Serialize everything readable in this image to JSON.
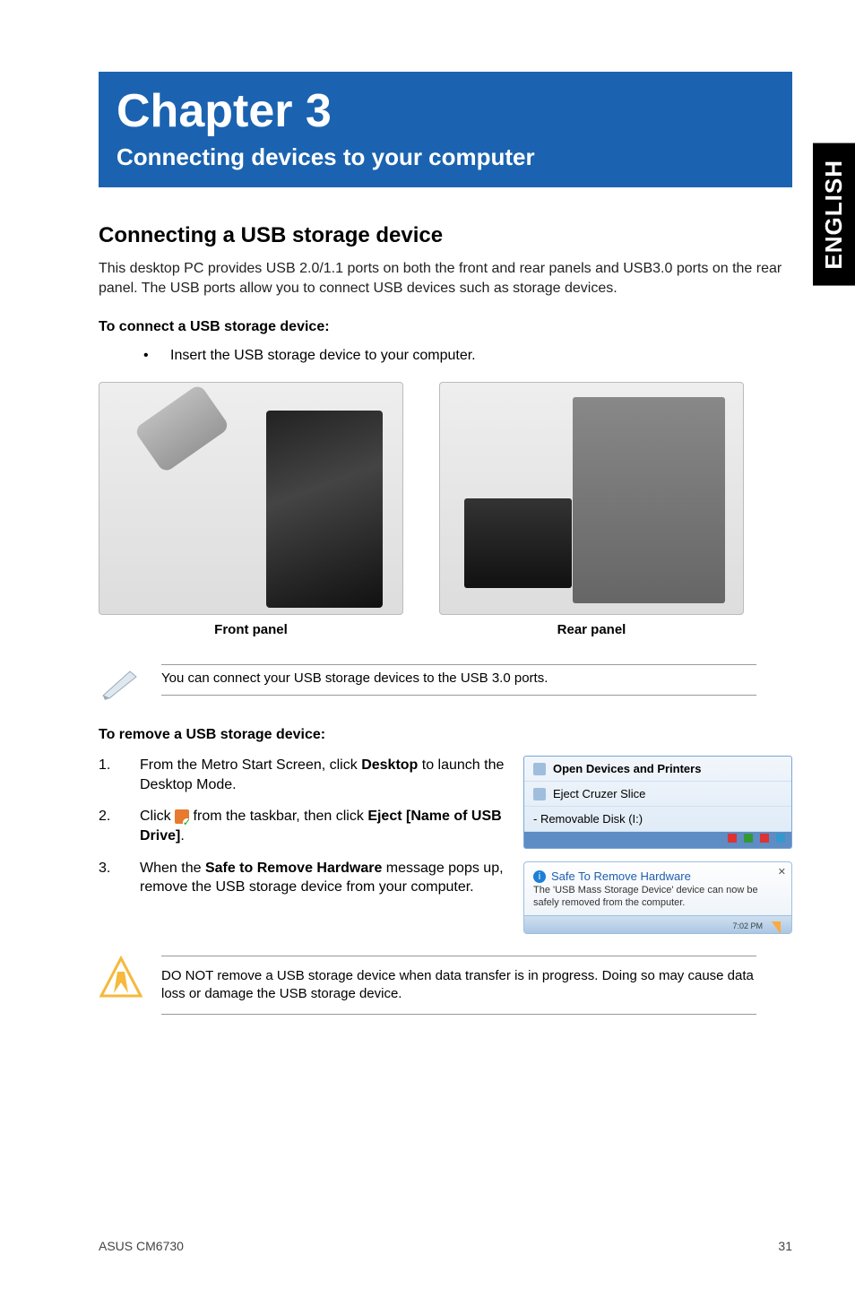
{
  "side_tab": "ENGLISH",
  "chapter": {
    "title": "Chapter 3",
    "subtitle": "Connecting devices to your computer"
  },
  "section1": {
    "heading": "Connecting a USB storage device",
    "body": "This desktop PC provides USB 2.0/1.1 ports on both the front and rear panels and USB3.0 ports on the rear panel. The USB ports allow you to connect USB devices such as storage devices.",
    "connect_head": "To connect a USB storage device:",
    "connect_bullet": "Insert the USB storage device to your computer.",
    "front_label": "Front panel",
    "rear_label": "Rear panel",
    "note": "You can connect your USB storage devices to the USB 3.0 ports."
  },
  "section2": {
    "heading": "To remove a USB storage device:",
    "steps": [
      {
        "num": "1.",
        "pre": "From the Metro Start Screen, click ",
        "bold": "Desktop",
        "post": " to launch the Desktop Mode."
      },
      {
        "num": "2.",
        "pre": "Click ",
        "mid": " from the taskbar, then click ",
        "bold": "Eject [Name of USB Drive]",
        "post": "."
      },
      {
        "num": "3.",
        "pre": "When the ",
        "bold": "Safe to Remove Hardware",
        "post": " message pops up, remove the USB storage device from your computer."
      }
    ],
    "menu": {
      "open_devices": "Open Devices and Printers",
      "eject": "Eject Cruzer Slice",
      "disk": "-   Removable Disk (I:)"
    },
    "balloon": {
      "title": "Safe To Remove Hardware",
      "msg": "The 'USB Mass Storage Device' device can now be safely removed from the computer.",
      "time": "7:02 PM"
    },
    "warning": "DO NOT remove a USB storage device when data transfer is in progress. Doing so may cause data loss or damage the USB storage device."
  },
  "footer": {
    "left": "ASUS CM6730",
    "right": "31"
  }
}
